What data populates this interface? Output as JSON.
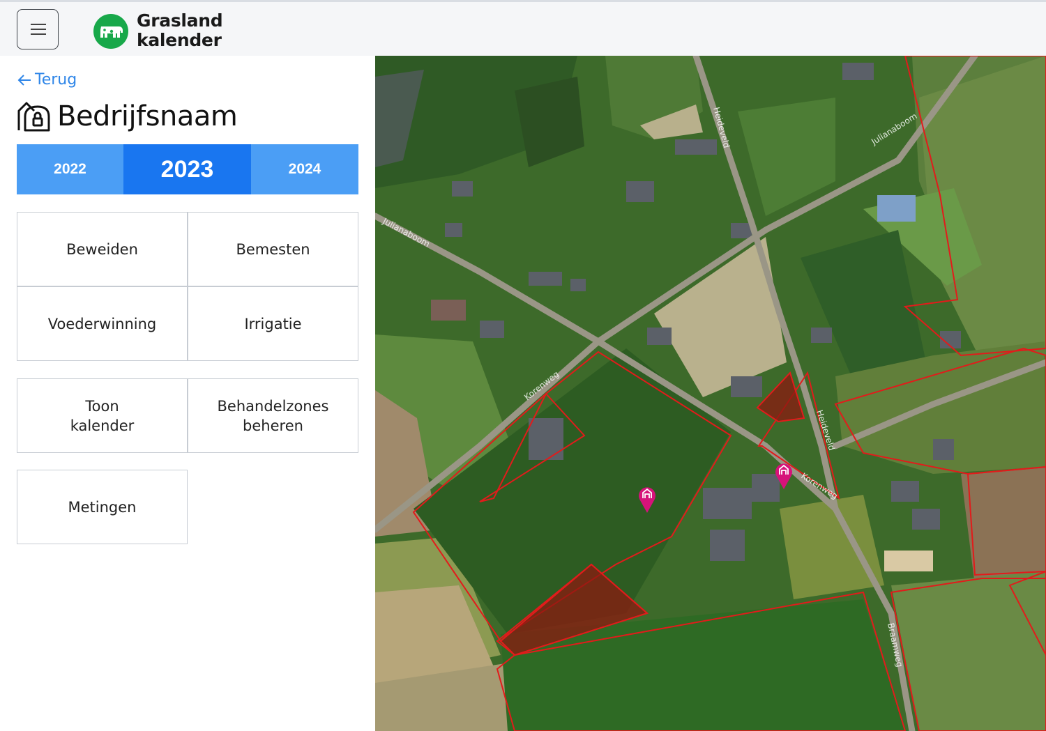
{
  "header": {
    "app_name_line1": "Grasland",
    "app_name_line2": "kalender",
    "menu_icon": "hamburger-icon",
    "logo_icon": "cow-icon",
    "logo_color": "#18a84a"
  },
  "sidebar": {
    "back_label": "Terug",
    "farm_name": "Bedrijfsnaam",
    "farm_icon": "farm-building-icon",
    "years": [
      {
        "label": "2022",
        "active": false
      },
      {
        "label": "2023",
        "active": true
      },
      {
        "label": "2024",
        "active": false
      }
    ],
    "actions_primary": [
      {
        "label": "Beweiden"
      },
      {
        "label": "Bemesten"
      },
      {
        "label": "Voederwinning"
      },
      {
        "label": "Irrigatie"
      }
    ],
    "actions_secondary": [
      {
        "label": "Toon\nkalender"
      },
      {
        "label": "Behandelzones\nbeheren"
      },
      {
        "label": "Metingen"
      }
    ]
  },
  "map": {
    "street_labels": [
      "Julianaboom",
      "Julianaboom",
      "Heideveld",
      "Heideveld",
      "Korenweg",
      "Korenweg",
      "Braamweg"
    ],
    "parcel_outline_color": "#e21b1b",
    "zone_fill_color": "#8b1a10",
    "marker_icon": "farm-marker-icon",
    "marker_color": "#d6127a"
  },
  "colors": {
    "accent": "#1976f0",
    "tab": "#4b9ef5",
    "link": "#2f86e8"
  }
}
